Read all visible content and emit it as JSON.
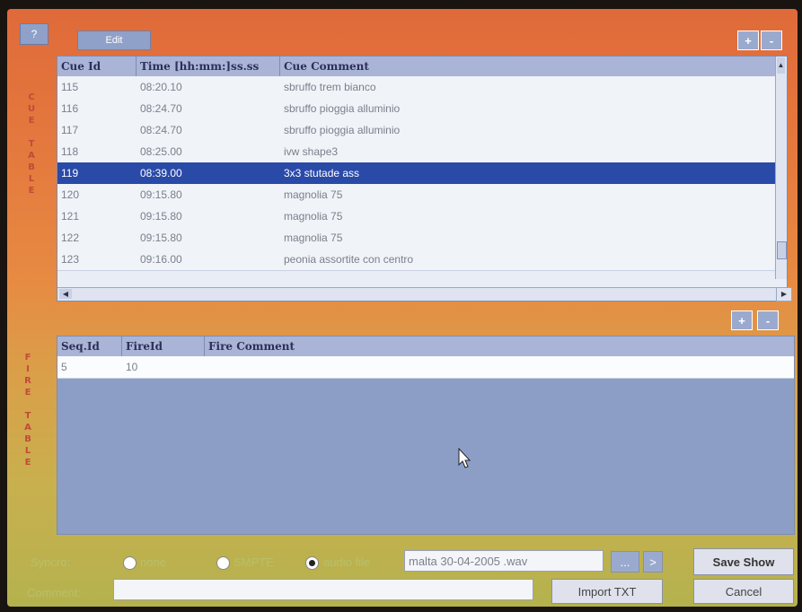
{
  "top": {
    "help_label": "?",
    "edit_label": "Edit",
    "add_label": "+",
    "remove_label": "-"
  },
  "cue_label_letters": [
    "C",
    "U",
    "E",
    "",
    "T",
    "A",
    "B",
    "L",
    "E"
  ],
  "fire_label_letters": [
    "F",
    "I",
    "R",
    "E",
    "",
    "T",
    "A",
    "B",
    "L",
    "E"
  ],
  "cue_table": {
    "columns": [
      "Cue Id",
      "Time [hh:mm:]ss.ss",
      "Cue Comment"
    ],
    "rows": [
      {
        "id": "115",
        "time": "08:20.10",
        "comment": "sbruffo trem bianco"
      },
      {
        "id": "116",
        "time": "08:24.70",
        "comment": "sbruffo pioggia alluminio"
      },
      {
        "id": "117",
        "time": "08:24.70",
        "comment": "sbruffo pioggia alluminio"
      },
      {
        "id": "118",
        "time": "08:25.00",
        "comment": "ivw shape3"
      },
      {
        "id": "119",
        "time": "08:39.00",
        "comment": "3x3 stutade ass"
      },
      {
        "id": "120",
        "time": "09:15.80",
        "comment": "magnolia 75"
      },
      {
        "id": "121",
        "time": "09:15.80",
        "comment": "magnolia 75"
      },
      {
        "id": "122",
        "time": "09:15.80",
        "comment": "magnolia 75"
      },
      {
        "id": "123",
        "time": "09:16.00",
        "comment": "peonia assortite con centro"
      }
    ],
    "selected_row": 4
  },
  "fire_table": {
    "add_label": "+",
    "remove_label": "-",
    "columns": [
      "Seq.Id",
      "FireId",
      "Fire Comment"
    ],
    "rows": [
      {
        "seq": "5",
        "fire": "10",
        "comment": ""
      }
    ]
  },
  "bottom": {
    "syncro_label": "Syncro:",
    "radio_none": "none",
    "radio_smpte": "SMPTE",
    "radio_audio": "audio file",
    "selected_sync": "audio file",
    "audio_file_value": "malta 30-04-2005 .wav",
    "browse_label": "...",
    "play_label": ">",
    "save_label": "Save Show",
    "comment_label": "Comment:",
    "comment_value": "",
    "import_label": "Import TXT",
    "cancel_label": "Cancel"
  }
}
